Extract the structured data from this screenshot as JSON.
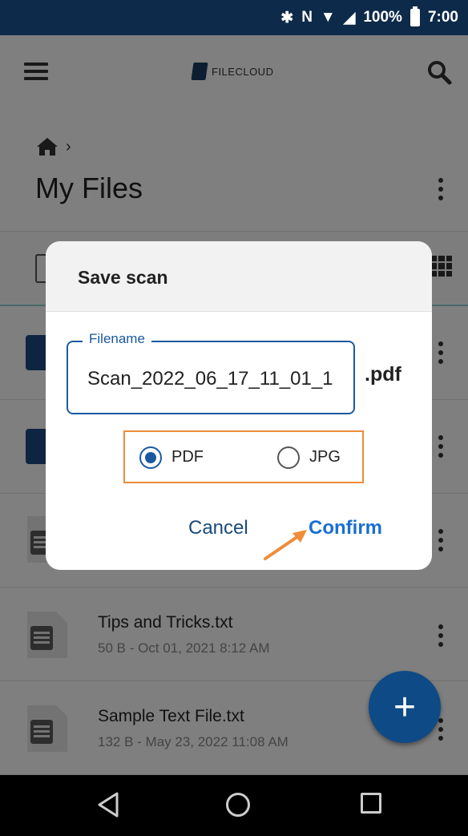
{
  "status_bar": {
    "battery": "100%",
    "time": "7:00"
  },
  "app": {
    "logo_text": "FILECLOUD"
  },
  "page": {
    "title": "My Files",
    "breadcrumb_sep": "›"
  },
  "files": [
    {
      "name": "Tips and Tricks.txt",
      "meta": "50 B - Oct 01, 2021 8:12 AM"
    },
    {
      "name": "Sample Text File.txt",
      "meta": "132 B - May 23, 2022 11:08 AM"
    }
  ],
  "dialog": {
    "title": "Save scan",
    "field_label": "Filename",
    "field_value": "Scan_2022_06_17_11_01_1",
    "extension": ".pdf",
    "options": [
      {
        "label": "PDF",
        "selected": true
      },
      {
        "label": "JPG",
        "selected": false
      }
    ],
    "cancel_label": "Cancel",
    "confirm_label": "Confirm"
  },
  "colors": {
    "accent": "#1a5aa0",
    "highlight": "#f08c3a",
    "fab": "#0e4a85"
  }
}
